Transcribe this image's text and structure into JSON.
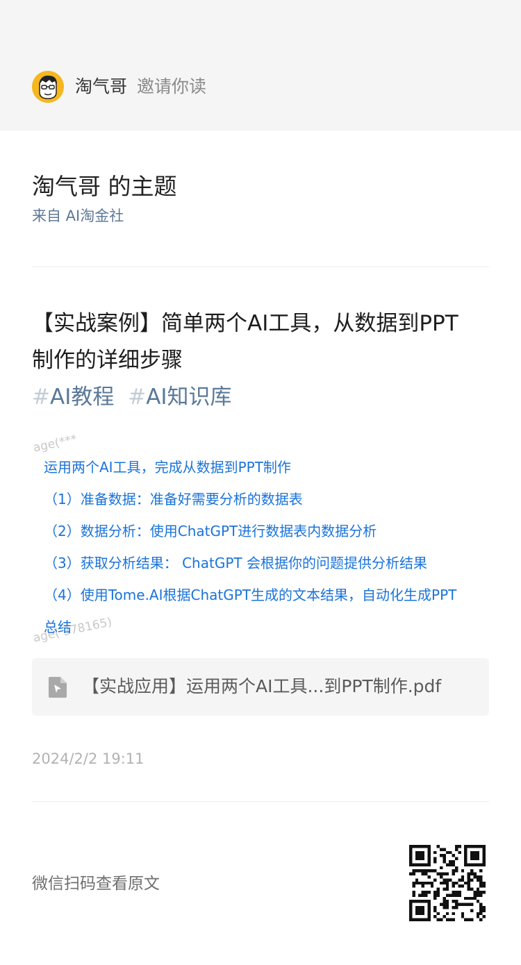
{
  "invite": {
    "name": "淘气哥",
    "suffix": "邀请你读"
  },
  "topic": {
    "title": "淘气哥 的主题",
    "source": "来自 AI淘金社"
  },
  "post": {
    "title_lines": [
      "【实战案例】简单两个AI工具，从数据到PPT",
      "制作的详细步骤"
    ],
    "tags": [
      "AI教程",
      "AI知识库"
    ],
    "tag_hash": "#",
    "body_lines": [
      "运用两个AI工具，完成从数据到PPT制作",
      "（1）准备数据：准备好需要分析的数据表",
      "（2）数据分析：使用ChatGPT进行数据表内数据分析",
      "（3）获取分析结果： ChatGPT 会根据你的问题提供分析结果",
      "（4）使用Tome.AI根据ChatGPT生成的文本结果，自动化生成PPT",
      "总结"
    ],
    "watermarks": [
      "age(***",
      "age(   378165)"
    ],
    "attachment": {
      "icon": "pdf-file-icon",
      "name": "【实战应用】运用两个AI工具...到PPT制作.pdf"
    },
    "date": "2024/2/2 19:11"
  },
  "footer": {
    "scan_hint": "微信扫码查看原文",
    "qr_icon": "qr-code"
  },
  "colors": {
    "link_blue": "#1a73d9",
    "tag_blue": "#5a7899",
    "avatar_yellow": "#f5b720"
  }
}
